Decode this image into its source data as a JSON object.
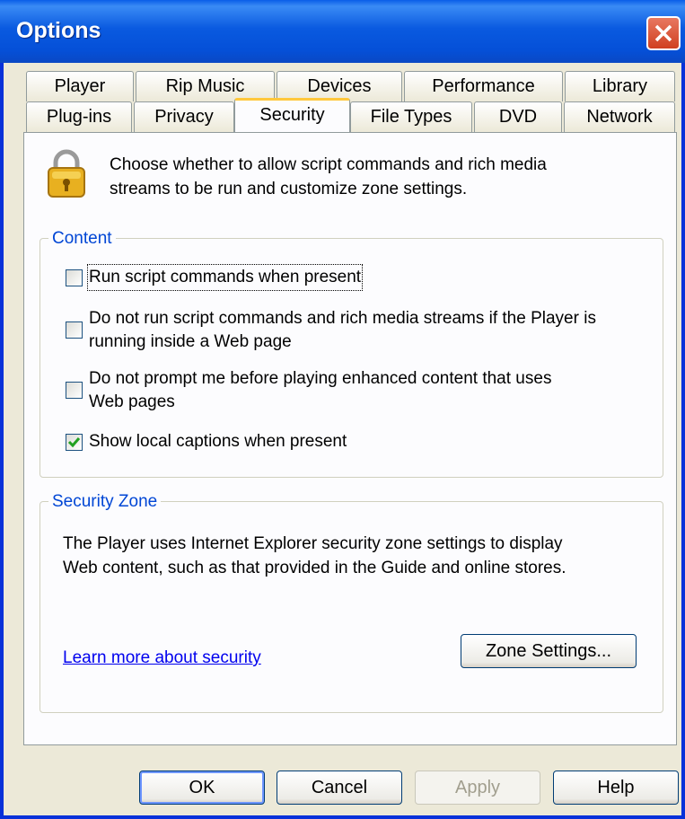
{
  "window": {
    "title": "Options"
  },
  "tabs_row1": [
    "Player",
    "Rip Music",
    "Devices",
    "Performance",
    "Library"
  ],
  "tabs_row2": [
    "Plug-ins",
    "Privacy",
    "Security",
    "File Types",
    "DVD",
    "Network"
  ],
  "active_tab": "Security",
  "intro": {
    "line1": "Choose whether to allow script commands and rich media",
    "line2": "streams to be run and customize zone settings."
  },
  "content_group": {
    "legend": "Content",
    "options": [
      {
        "line1": "Run script commands when present",
        "line2": "",
        "checked": false
      },
      {
        "line1": "Do not run script commands and rich media streams if the Player is",
        "line2": "running inside a Web page",
        "checked": false
      },
      {
        "line1": "Do not prompt me before playing enhanced content that uses",
        "line2": "Web pages",
        "checked": false
      },
      {
        "line1": "Show local captions when present",
        "line2": "",
        "checked": true
      }
    ]
  },
  "zone_group": {
    "legend": "Security Zone",
    "line1": "The Player uses Internet Explorer security zone settings to display",
    "line2": "Web content, such as that provided in the Guide and online stores.",
    "link": "Learn more about security",
    "zone_button": "Zone Settings..."
  },
  "buttons": {
    "ok": "OK",
    "cancel": "Cancel",
    "apply": "Apply",
    "help": "Help"
  },
  "colors": {
    "titlebar": "#0a5ee8",
    "dialog_bg": "#ece9d8",
    "legend": "#0046d5",
    "link": "#0000ee",
    "active_tab_accent": "#ffc83c"
  }
}
